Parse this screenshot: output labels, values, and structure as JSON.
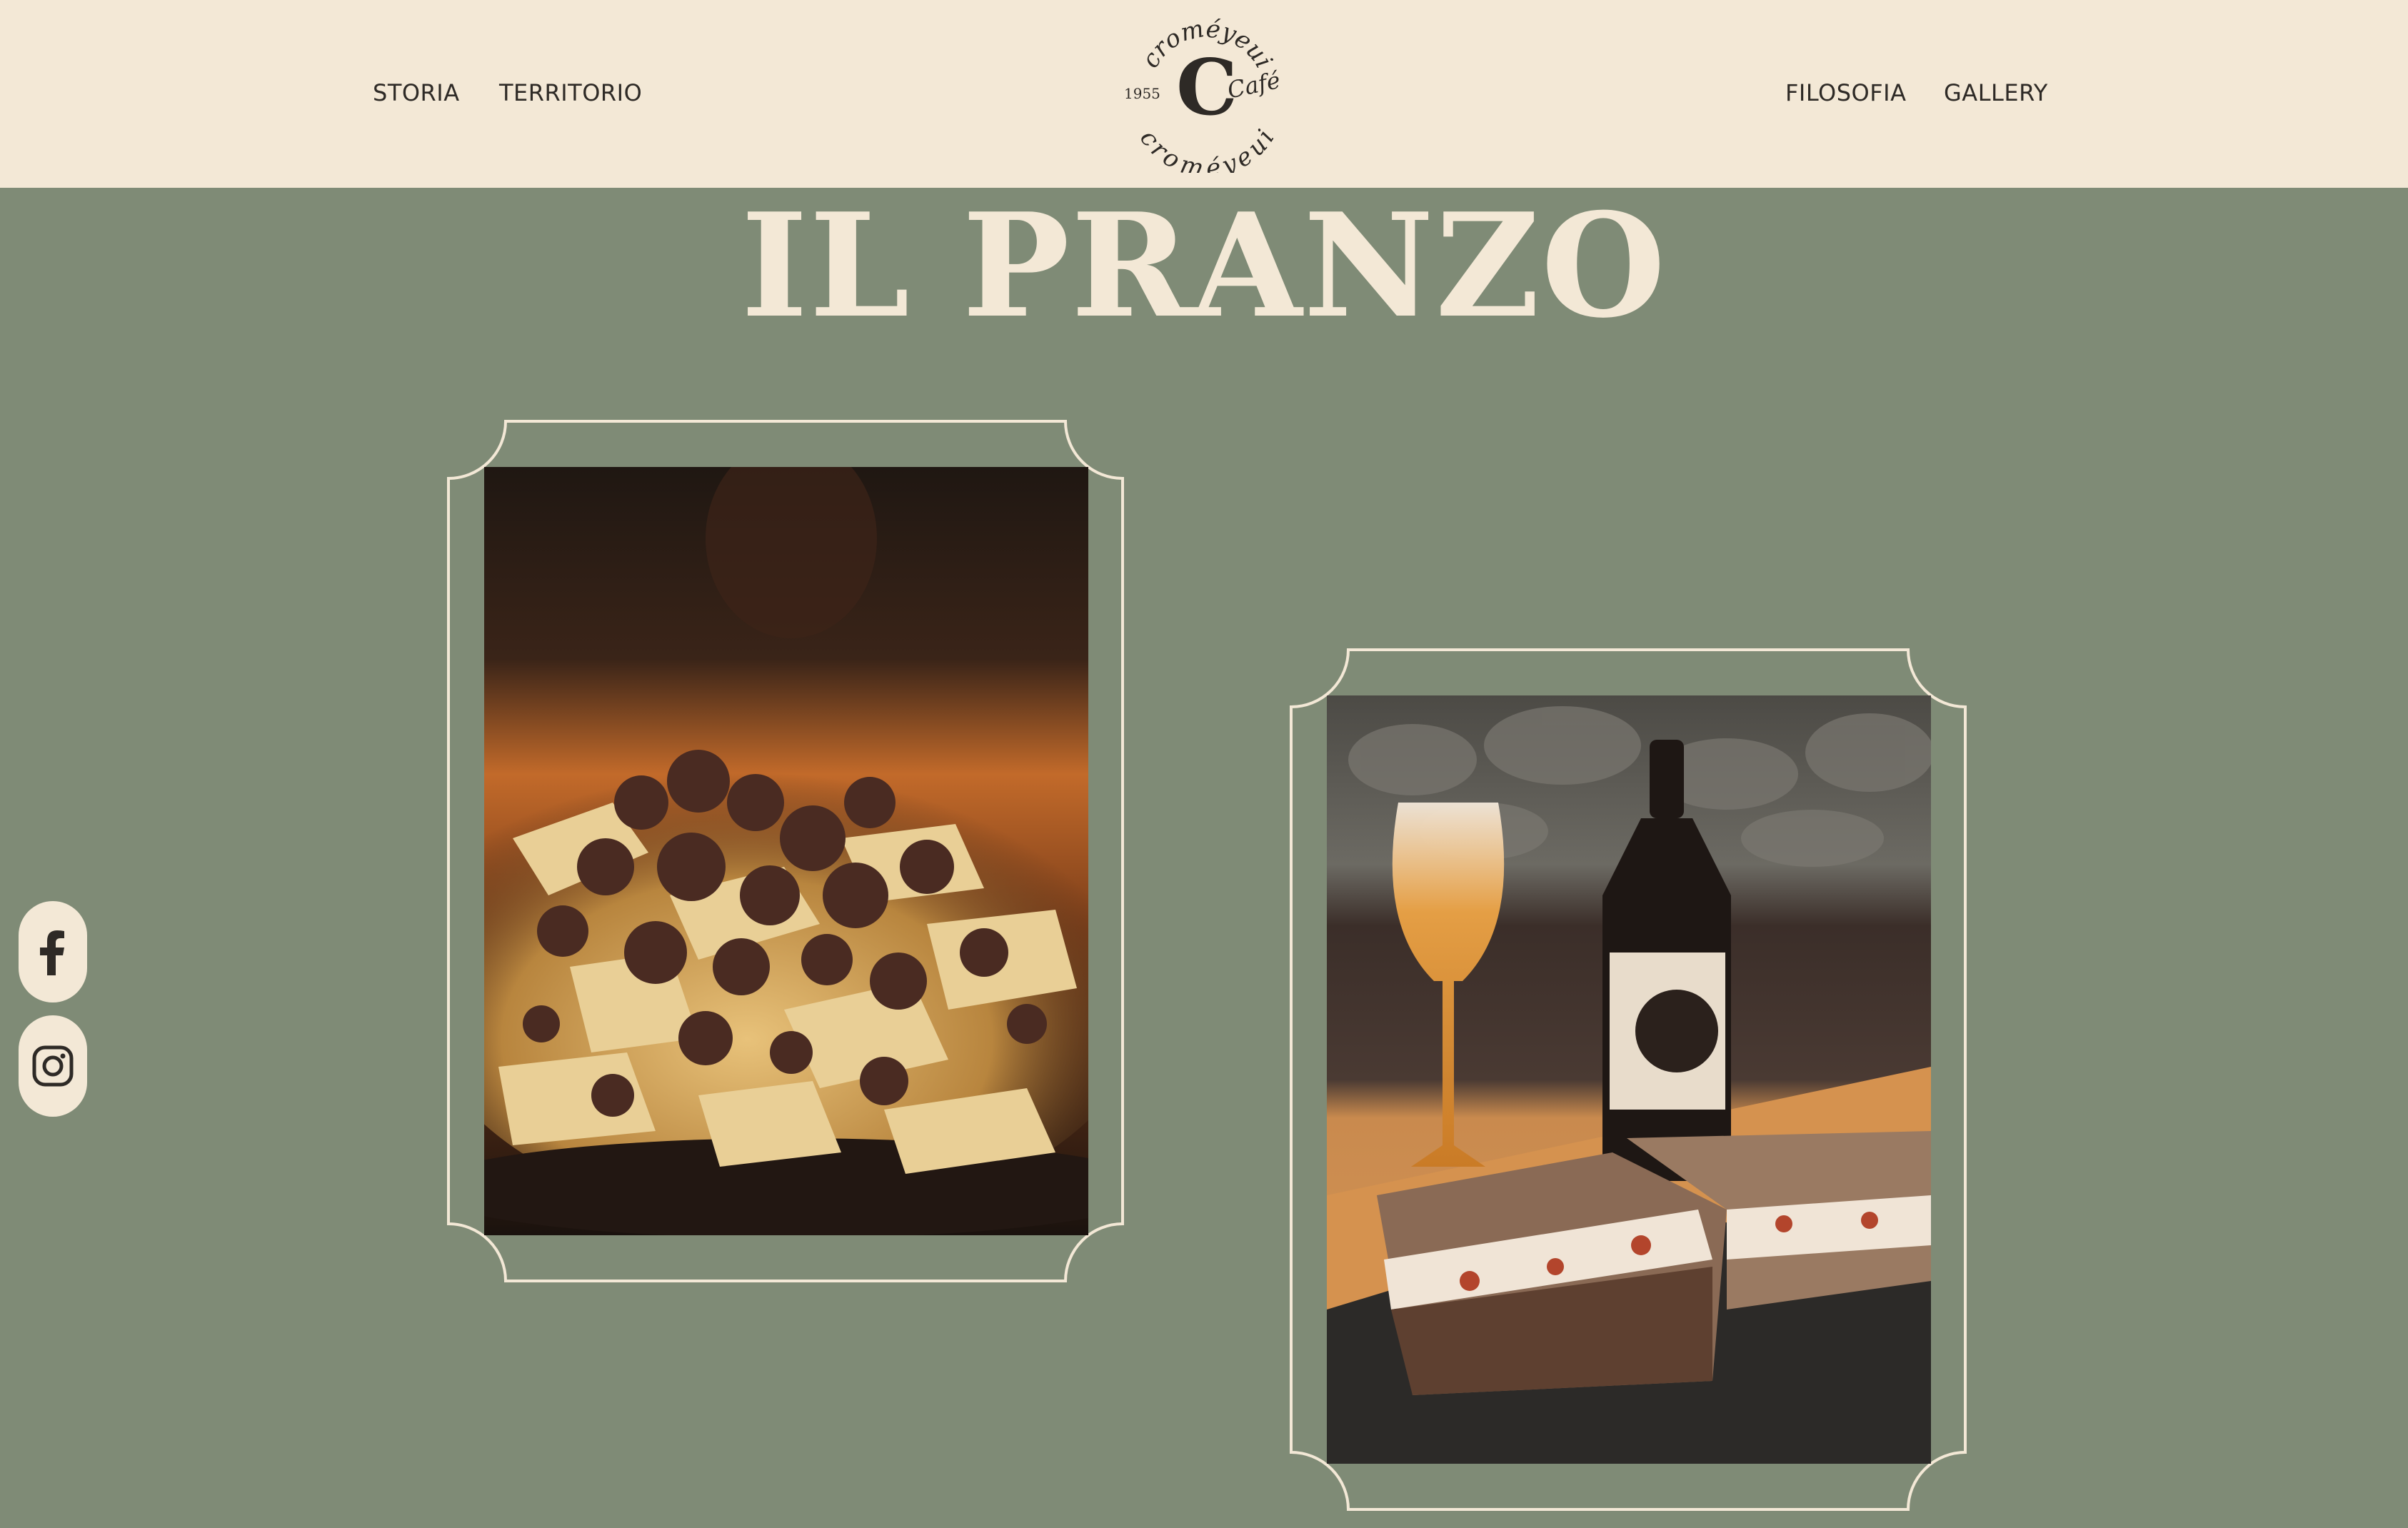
{
  "header": {
    "nav_left": [
      "STORIA",
      "TERRITORIO"
    ],
    "nav_right": [
      "FILOSOFIA",
      "GALLERY"
    ],
    "logo": {
      "name_top": "croméyeui",
      "name_bottom": "croméyeui",
      "year": "1955",
      "script": "Café",
      "monogram": "C"
    }
  },
  "main": {
    "title": "IL PRANZO"
  },
  "social": [
    {
      "name": "facebook",
      "icon": "facebook-icon"
    },
    {
      "name": "instagram",
      "icon": "instagram-icon"
    }
  ],
  "colors": {
    "background": "#7f8b76",
    "header": "#f3e8d6",
    "text_dark": "#2e2a26",
    "cream": "#f3e8d6"
  }
}
